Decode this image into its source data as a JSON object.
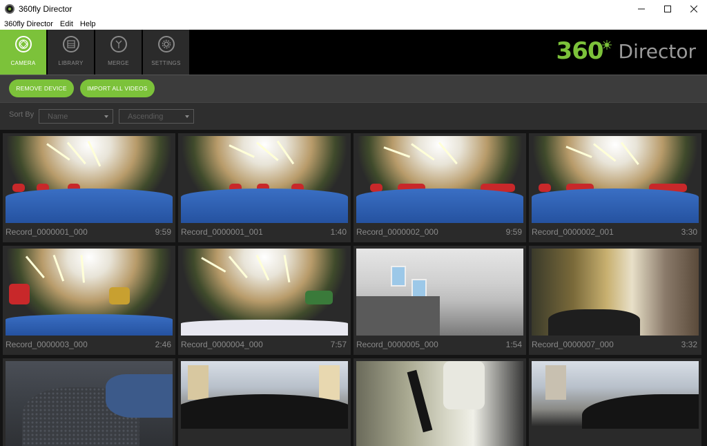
{
  "window": {
    "title": "360fly Director",
    "controls": {
      "minimize": "—",
      "maximize": "☐",
      "close": "✕"
    }
  },
  "menu": [
    "360fly Director",
    "Edit",
    "Help"
  ],
  "nav": {
    "tabs": [
      {
        "label": "CAMERA",
        "icon": "camera-icon",
        "active": true
      },
      {
        "label": "LIBRARY",
        "icon": "film-icon",
        "active": false
      },
      {
        "label": "MERGE",
        "icon": "merge-icon",
        "active": false
      },
      {
        "label": "SETTINGS",
        "icon": "gear-icon",
        "active": false
      }
    ],
    "brand": {
      "number": "360",
      "word": "Director"
    }
  },
  "toolbar": {
    "remove_label": "REMOVE DEVICE",
    "import_label": "IMPORT ALL VIDEOS"
  },
  "sort": {
    "label": "Sort By",
    "field": "Name",
    "order": "Ascending"
  },
  "videos": [
    {
      "name": "Record_0000001_000",
      "duration": "9:59",
      "scene": "gym"
    },
    {
      "name": "Record_0000001_001",
      "duration": "1:40",
      "scene": "gym"
    },
    {
      "name": "Record_0000002_000",
      "duration": "9:59",
      "scene": "gym"
    },
    {
      "name": "Record_0000002_001",
      "duration": "3:30",
      "scene": "gym"
    },
    {
      "name": "Record_0000003_000",
      "duration": "2:46",
      "scene": "gym"
    },
    {
      "name": "Record_0000004_000",
      "duration": "7:57",
      "scene": "gym"
    },
    {
      "name": "Record_0000005_000",
      "duration": "1:54",
      "scene": "office"
    },
    {
      "name": "Record_0000007_000",
      "duration": "3:32",
      "scene": "room"
    },
    {
      "name": "",
      "duration": "",
      "scene": "car"
    },
    {
      "name": "",
      "duration": "",
      "scene": "street"
    },
    {
      "name": "",
      "duration": "",
      "scene": "run"
    },
    {
      "name": "",
      "duration": "",
      "scene": "street"
    }
  ],
  "colors": {
    "accent": "#7cc23a",
    "nav_bg": "#000000",
    "toolbar_bg": "#3c3c3c",
    "grid_bg": "#141414"
  }
}
